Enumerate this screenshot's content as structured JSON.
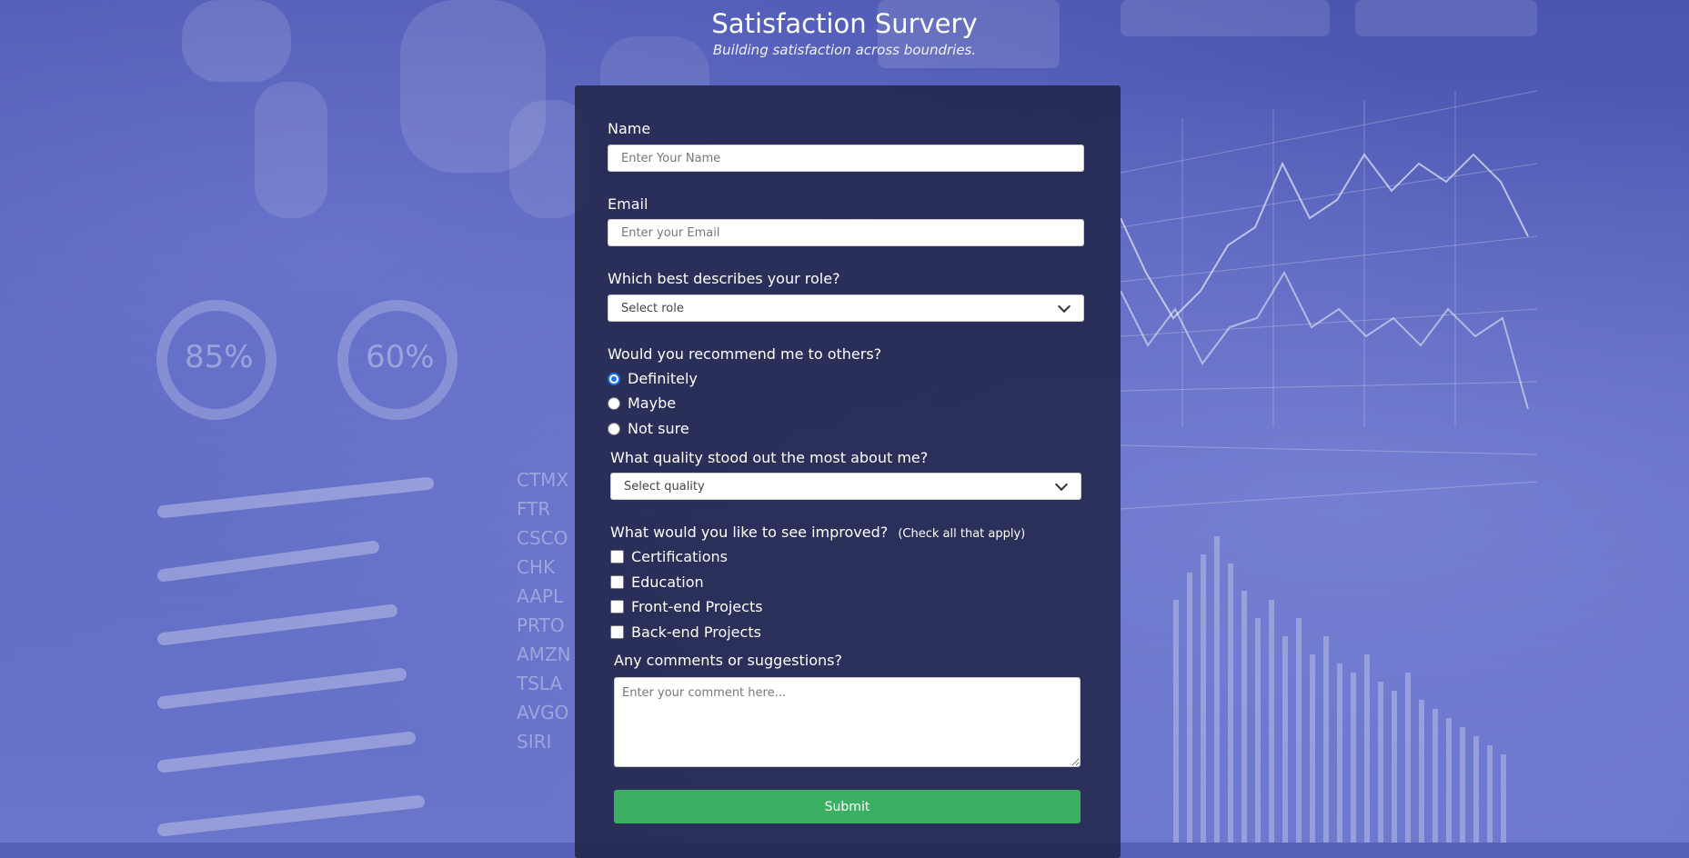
{
  "header": {
    "title": "Satisfaction Survery",
    "subtitle": "Building satisfaction across boundries."
  },
  "background": {
    "rings": [
      "85%",
      "60%"
    ],
    "tickers": [
      "CTMX",
      "FTR",
      "CSCO",
      "CHK",
      "AAPL",
      "PRTO",
      "AMZN",
      "TSLA",
      "AVGO",
      "SIRI"
    ]
  },
  "form": {
    "name": {
      "label": "Name",
      "placeholder": "Enter Your Name"
    },
    "email": {
      "label": "Email",
      "placeholder": "Enter your Email"
    },
    "role": {
      "label": "Which best describes your role?",
      "selected": "Select role"
    },
    "recommend": {
      "label": "Would you recommend me to others?",
      "options": [
        "Definitely",
        "Maybe",
        "Not sure"
      ],
      "selected": "Definitely"
    },
    "quality": {
      "label": "What quality stood out the most about me?",
      "selected": "Select quality"
    },
    "improve": {
      "label": "What would you like to see improved?",
      "hint": "(Check all that apply)",
      "options": [
        "Certifications",
        "Education",
        "Front-end Projects",
        "Back-end Projects"
      ]
    },
    "comments": {
      "label": "Any comments or suggestions?",
      "placeholder": "Enter your comment here..."
    },
    "submit_label": "Submit"
  },
  "colors": {
    "card": "#24284e",
    "submit": "#3cb062",
    "radio_accent": "#1a73e8"
  }
}
